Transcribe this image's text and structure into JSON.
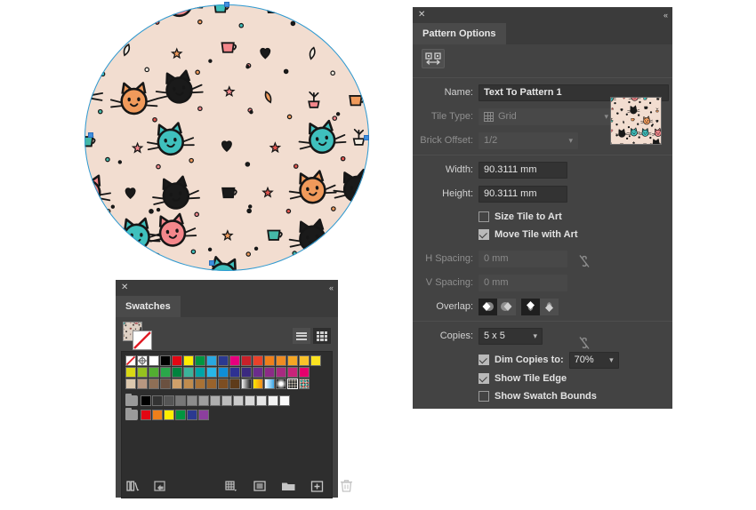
{
  "artboard": {
    "name": "artboard-canvas",
    "shape": "circle",
    "fill_pattern_name": "Text To Pattern 1",
    "background_color": "#f2ddd0",
    "selection_color": "#2d9bd4",
    "anchor_color": "#3e8ede",
    "pattern_colors": {
      "teal": "#3fc0bd",
      "pink": "#f4878b",
      "black": "#1a1a1a",
      "orange": "#f09a5b",
      "red": "#e2564f",
      "cream": "#f6efe4",
      "leaf": "#45b8a8"
    }
  },
  "pattern_panel": {
    "title": "Pattern Options",
    "close_icon": "✕",
    "collapse_icon": "«",
    "menu_icon": "hamburger-menu",
    "tile_tool_icon": "pattern-tile-tool",
    "name": {
      "label": "Name:",
      "value": "Text To Pattern 1"
    },
    "tile_type": {
      "label": "Tile Type:",
      "value": "Grid",
      "icon": "grid-icon",
      "disabled": true
    },
    "brick_offset": {
      "label": "Brick Offset:",
      "value": "1/2",
      "disabled": true
    },
    "width": {
      "label": "Width:",
      "value": "90.3111 mm"
    },
    "height": {
      "label": "Height:",
      "value": "90.3111 mm"
    },
    "dimension_link_icon": "link-broken-icon",
    "size_tile_to_art": {
      "label": "Size Tile to Art",
      "checked": false
    },
    "move_tile_with_art": {
      "label": "Move Tile with Art",
      "checked": true
    },
    "h_spacing": {
      "label": "H Spacing:",
      "value": "0 mm",
      "disabled": true
    },
    "v_spacing": {
      "label": "V Spacing:",
      "value": "0 mm",
      "disabled": true
    },
    "spacing_link_icon": "link-broken-icon",
    "overlap": {
      "label": "Overlap:",
      "options": [
        {
          "name": "left-in-front",
          "selected": true
        },
        {
          "name": "right-in-front",
          "selected": false
        },
        {
          "name": "top-in-front",
          "selected": true
        },
        {
          "name": "bottom-in-front",
          "selected": false
        }
      ]
    },
    "copies": {
      "label": "Copies:",
      "value": "5 x 5"
    },
    "dim_copies": {
      "label": "Dim Copies to:",
      "checked": true,
      "value": "70%"
    },
    "show_tile_edge": {
      "label": "Show Tile Edge",
      "checked": true
    },
    "show_swatch_bounds": {
      "label": "Show Swatch Bounds",
      "checked": false
    }
  },
  "swatches_panel": {
    "title": "Swatches",
    "close_icon": "✕",
    "collapse_icon": "«",
    "menu_icon": "hamburger-menu",
    "fill_swatch": "pattern-fill",
    "stroke_swatch": "none-stroke",
    "view_list_icon": "list-view-icon",
    "view_grid_icon": "grid-view-icon",
    "active_view": "grid",
    "rows": [
      {
        "name": "row-1",
        "swatches": [
          "none",
          "registration",
          "#ffffff",
          "#000000",
          "#e30613",
          "#ffed00",
          "#009640",
          "#29a8e0",
          "#2b3990",
          "#e6007e",
          "#c8202a",
          "#e8412a",
          "#ef7f1a",
          "#ef8b22",
          "#f5a623",
          "#f9c22b",
          "#fbe220"
        ]
      },
      {
        "name": "row-2",
        "swatches": [
          "#d9d814",
          "#95c11f",
          "#52ae32",
          "#2aa84a",
          "#00833e",
          "#3cb39a",
          "#00a4a7",
          "#29b6e8",
          "#0f8ed8",
          "#2e3192",
          "#3b2a80",
          "#6b2d8c",
          "#8c2b86",
          "#a82a80",
          "#c8247a",
          "#e5006d"
        ]
      },
      {
        "name": "row-3",
        "swatches": [
          "#dcc8ae",
          "#b79781",
          "#8e6f56",
          "#6b5140",
          "#cfa06a",
          "#c08c4e",
          "#a87236",
          "#99632c",
          "#7d4e22",
          "#5e3b1a",
          "gradient-gray",
          "gradient-yellow",
          "gradient-blue",
          "gradient-radial",
          "pattern-dots",
          "pattern-cats"
        ]
      }
    ],
    "group_gray": {
      "name": "grayscale-group",
      "folder_icon": "folder-icon",
      "swatches": [
        "#000000",
        "#333333",
        "#555555",
        "#777777",
        "#8c8c8c",
        "#9e9e9e",
        "#aeaeae",
        "#bcbcbc",
        "#cacaca",
        "#d8d8d8",
        "#e6e6e6",
        "#f2f2f2",
        "#fafafa"
      ]
    },
    "group_color": {
      "name": "color-group",
      "folder_icon": "folder-icon",
      "swatches": [
        "#e30613",
        "#ef7f1a",
        "#ffed00",
        "#009640",
        "#2b3990",
        "#8c3f9e"
      ]
    },
    "bottom_bar": [
      {
        "name": "swatch-libraries-menu",
        "icon": "books-icon"
      },
      {
        "name": "swatch-library-link",
        "icon": "link-library-icon"
      },
      {
        "name": "show-swatch-kinds-menu",
        "icon": "kinds-grid-icon"
      },
      {
        "name": "swatch-options",
        "icon": "options-list-icon"
      },
      {
        "name": "new-color-group",
        "icon": "folder-icon"
      },
      {
        "name": "new-swatch",
        "icon": "plus-box-icon"
      },
      {
        "name": "delete-swatch",
        "icon": "trash-icon"
      }
    ]
  }
}
